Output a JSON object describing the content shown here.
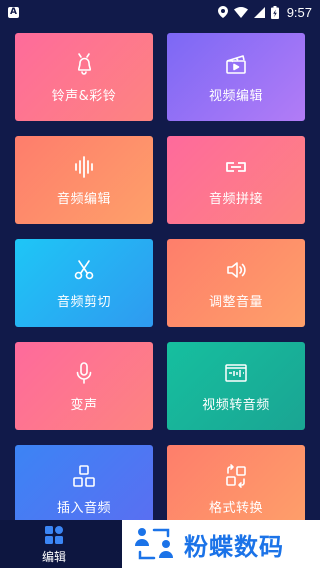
{
  "status": {
    "app_badge": "A",
    "time": "9:57"
  },
  "tiles": [
    {
      "label": "铃声&彩铃",
      "icon": "bell-icon"
    },
    {
      "label": "视频编辑",
      "icon": "video-clapper-icon"
    },
    {
      "label": "音频编辑",
      "icon": "waveform-icon"
    },
    {
      "label": "音频拼接",
      "icon": "link-icon"
    },
    {
      "label": "音频剪切",
      "icon": "scissors-icon"
    },
    {
      "label": "调整音量",
      "icon": "speaker-icon"
    },
    {
      "label": "变声",
      "icon": "microphone-icon"
    },
    {
      "label": "视频转音频",
      "icon": "video-to-audio-icon"
    },
    {
      "label": "插入音频",
      "icon": "insert-blocks-icon"
    },
    {
      "label": "格式转换",
      "icon": "convert-icon"
    }
  ],
  "colors": {
    "background": "#111a4a",
    "pink": "#fd6f8f",
    "purple": "#8d6bf6",
    "orange": "#fe8a6a",
    "cyan": "#25b8f3",
    "teal": "#17bfa0",
    "blue": "#4479f3",
    "brand_blue": "#1b73e8"
  },
  "bottom_nav": {
    "edit_label": "编辑",
    "icon": "grid-icon"
  },
  "brand": {
    "text": "粉蝶数码",
    "icon": "user-sync-icon"
  }
}
